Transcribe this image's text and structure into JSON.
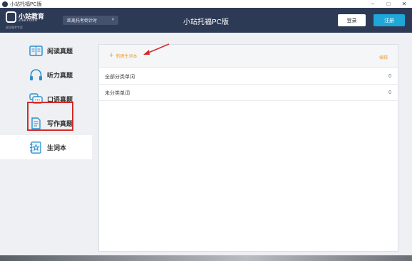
{
  "window": {
    "title": "小站托福PC版",
    "controls": {
      "minimize": "−",
      "maximize": "□",
      "close": "✕"
    }
  },
  "header": {
    "logo": {
      "title": "小站教育",
      "domain": "zhan.com",
      "subtitle": "留学备考专家"
    },
    "countdown_label": "距离托考倒计时",
    "app_title": "小站托福PC版",
    "login_label": "登录",
    "register_label": "注册"
  },
  "sidebar": {
    "items": [
      {
        "label": "阅读真题",
        "icon": "book-icon"
      },
      {
        "label": "听力真题",
        "icon": "headphones-icon"
      },
      {
        "label": "口语真题",
        "icon": "speech-bubble-icon"
      },
      {
        "label": "写作真题",
        "icon": "document-icon"
      },
      {
        "label": "生词本",
        "icon": "notebook-star-icon",
        "active": true
      }
    ]
  },
  "main": {
    "new_vocab_label": "新建生词本",
    "new_vocab_icon": "+",
    "edit_label": "编辑",
    "rows": [
      {
        "name": "全部分类单词",
        "count": "0"
      },
      {
        "name": "未分类单词",
        "count": "0"
      }
    ]
  },
  "colors": {
    "header_bg": "#2d3a56",
    "accent_orange": "#f0a030",
    "register_blue": "#1ea7d8",
    "annotation_red": "#d32a2a",
    "icon_blue": "#2a8fd0"
  }
}
